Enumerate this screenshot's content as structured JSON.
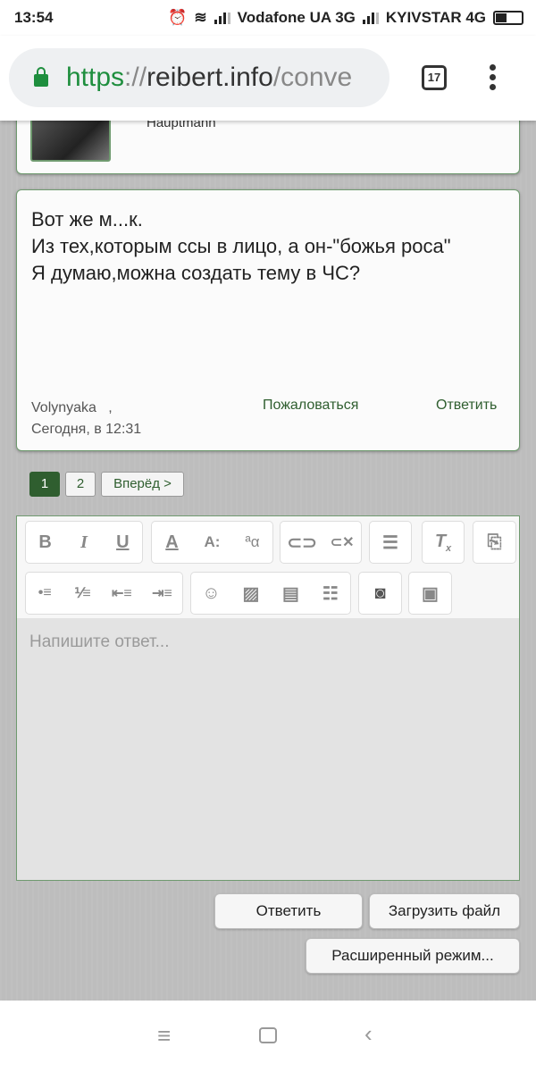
{
  "status": {
    "time": "13:54",
    "carrier1": "Vodafone UA 3G",
    "carrier2": "KYIVSTAR 4G"
  },
  "browser": {
    "url_scheme": "https",
    "url_sep": "://",
    "url_host": "reibert.info",
    "url_path": "/conve",
    "tab_count": "17"
  },
  "prev_post": {
    "rank": "Hauptmann"
  },
  "post": {
    "lines": [
      "Вот же м...к.",
      "Из тех,которым ссы в лицо, а он-\"божья роса\"",
      "Я думаю,можна создать тему в ЧС?"
    ],
    "author": "Volynyaka",
    "author_sep": ",",
    "time": "Сегодня, в 12:31",
    "report": "Пожаловаться",
    "reply": "Ответить"
  },
  "pagination": {
    "pages": [
      "1",
      "2"
    ],
    "current": "1",
    "next": "Вперёд >"
  },
  "editor": {
    "placeholder": "Напишите ответ...",
    "toolbar": {
      "bold": "B",
      "italic": "I",
      "underline": "U",
      "font_color": "A",
      "font_size": "A:",
      "font_family": "ªα"
    }
  },
  "actions": {
    "reply": "Ответить",
    "upload": "Загрузить файл",
    "advanced": "Расширенный режим..."
  },
  "colors": {
    "accent": "#2f5e2f",
    "border": "#6f9a6f",
    "secure": "#1e8e3e"
  }
}
